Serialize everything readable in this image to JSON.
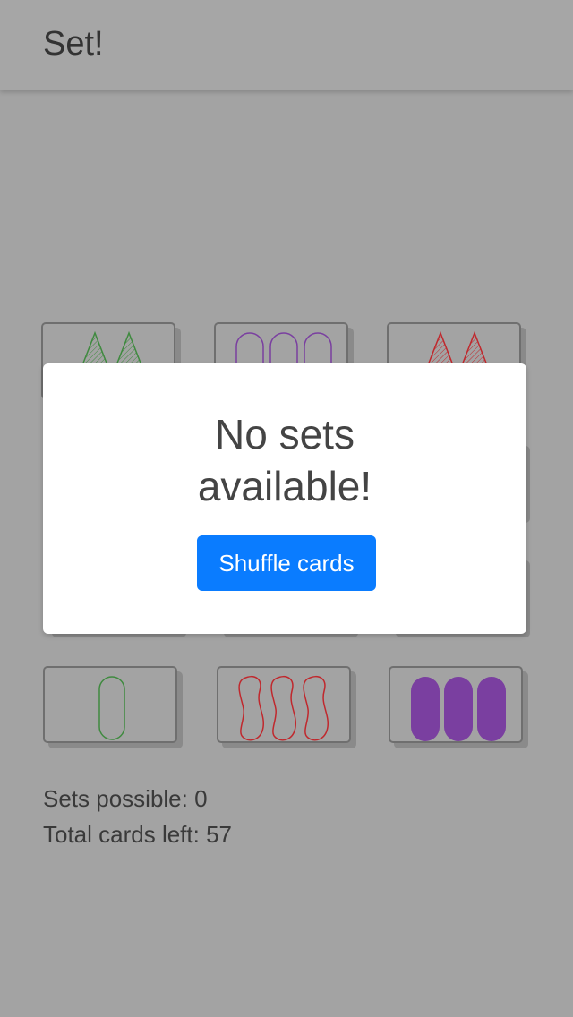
{
  "app": {
    "title": "Set!"
  },
  "cards": [
    {
      "id": "card-1",
      "shape": "triangle",
      "count": 2,
      "color": "#3f8a3f",
      "shading": "striped"
    },
    {
      "id": "card-2",
      "shape": "oval",
      "count": 3,
      "color": "#7a3fa0",
      "shading": "open"
    },
    {
      "id": "card-3",
      "shape": "triangle",
      "count": 2,
      "color": "#c0282d",
      "shading": "striped"
    },
    {
      "id": "card-10",
      "shape": "oval",
      "count": 1,
      "color": "#3f8a3f",
      "shading": "open"
    },
    {
      "id": "card-11",
      "shape": "squiggle",
      "count": 3,
      "color": "#c0282d",
      "shading": "open"
    },
    {
      "id": "card-12",
      "shape": "oval",
      "count": 3,
      "color": "#7a3fa0",
      "shading": "solid"
    }
  ],
  "stats": {
    "sets_possible": "Sets possible: 0",
    "cards_left": "Total cards left: 57"
  },
  "modal": {
    "message_line1": "No sets",
    "message_line2": "available!",
    "button_label": "Shuffle cards"
  },
  "colors": {
    "accent": "#0a7cff",
    "overlay_bg": "#a3a3a3",
    "green": "#3f8a3f",
    "purple": "#7a3fa0",
    "red": "#c0282d"
  }
}
